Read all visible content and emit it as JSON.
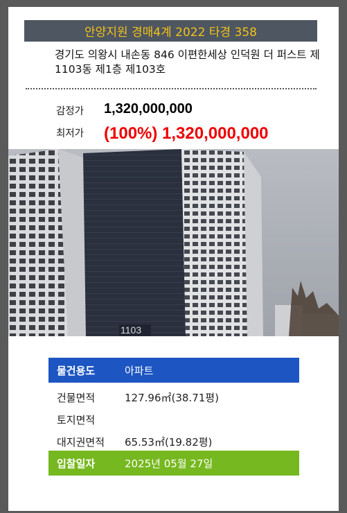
{
  "header": {
    "title": "안양지원 경매4계 2022 타경 358"
  },
  "address": "경기도 의왕시 내손동 846 이편한세상 인덕원 더 퍼스트 제1103동 제1층 제103호",
  "prices": {
    "appraisal_label": "감정가",
    "appraisal_value": "1,320,000,000",
    "minimum_label": "최저가",
    "minimum_value": "(100%) 1,320,000,000"
  },
  "photo": {
    "building_number": "1103"
  },
  "details": {
    "usage_label": "물건용도",
    "usage_value": "아파트",
    "building_area_label": "건물면적",
    "building_area_value": "127.96㎡(38.71평)",
    "land_area_label": "토지면적",
    "land_area_value": "",
    "land_right_label": "대지권면적",
    "land_right_value": "65.53㎡(19.82평)",
    "bid_date_label": "입찰일자",
    "bid_date_value": "2025년 05월 27일"
  },
  "colors": {
    "header_bg": "#4e5661",
    "header_text": "#f2c218",
    "price_red": "#ee0000",
    "usage_blue": "#1d56c2",
    "bid_green": "#76b81f",
    "frame_gray": "#5a5a5a"
  }
}
